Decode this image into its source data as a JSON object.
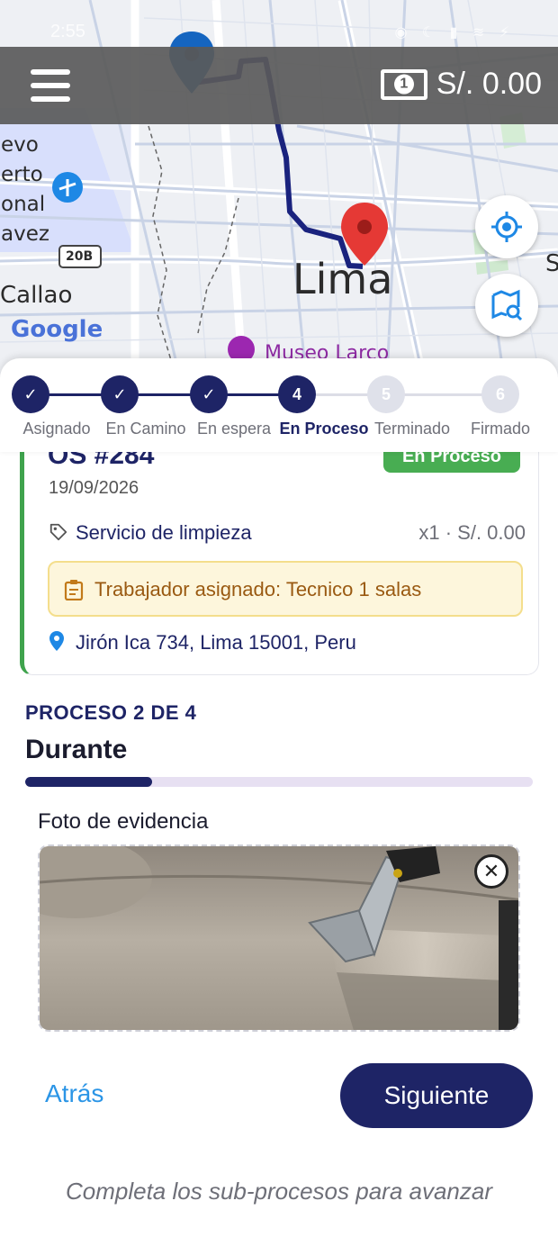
{
  "status_bar": {
    "time": "2:55",
    "icons": "◉ ☾ ▮ ≋ ⚡"
  },
  "map": {
    "labels": {
      "city": "Lima",
      "district": "Callao",
      "airport_fragments": [
        "evo",
        "erto",
        "onal",
        "avez"
      ],
      "road": "20B",
      "poi": "Museo Larco",
      "brand": "Google",
      "edge_letter": "S"
    }
  },
  "topbar": {
    "balance": "S/. 0.00"
  },
  "stepper": {
    "steps": [
      {
        "label": "Asignado",
        "number": "1",
        "state": "done"
      },
      {
        "label": "En Camino",
        "number": "2",
        "state": "done"
      },
      {
        "label": "En espera",
        "number": "3",
        "state": "done"
      },
      {
        "label": "En Proceso",
        "number": "4",
        "state": "current"
      },
      {
        "label": "Terminado",
        "number": "5",
        "state": "pending"
      },
      {
        "label": "Firmado",
        "number": "6",
        "state": "pending"
      }
    ]
  },
  "order": {
    "title": "OS #284",
    "status": "En Proceso",
    "date": "19/09/2026",
    "service": "Servicio de limpieza",
    "quantity_price": "x1 · S/. 0.00",
    "assigned_worker": "Trabajador asignado: Tecnico 1 salas",
    "address": "Jirón Ica 734, Lima 15001, Peru"
  },
  "process": {
    "step_label": "PROCESO 2 DE 4",
    "name": "Durante",
    "progress_fraction": 0.25,
    "photo_label": "Foto de evidencia"
  },
  "actions": {
    "back": "Atrás",
    "next": "Siguiente"
  },
  "hint": "Completa los sub-procesos para avanzar",
  "colors": {
    "primary": "#1e2466",
    "success": "#48ad52",
    "link": "#2b95e6",
    "marker": "#e53935",
    "location_blue": "#1e88e5"
  }
}
